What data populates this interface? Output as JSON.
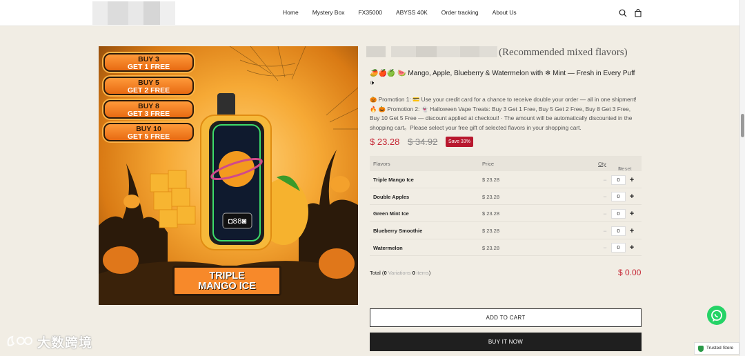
{
  "header": {
    "nav": [
      "Home",
      "Mystery Box",
      "FX35000",
      "ABYSS 40K",
      "Order tracking",
      "About Us"
    ]
  },
  "product": {
    "title": "(Recommended mixed flavors)",
    "tagline": "Mango, Apple, Blueberry & Watermelon with ❄ Mint — Fresh in Every Puff",
    "tagline_prefix": "🥭🍎🍏 🍉",
    "tagline_suffix": "🕩",
    "promo_text": "🎃 Promotion 1: 💳 Use your credit card for a chance to receive double your order — all in one shipment! 🔥 🎃 Promotion 2: 👻 Halloween Vape Treats: Buy 3 Get 1 Free, Buy 5 Get 2 Free, Buy 8 Get 3 Free, Buy 10 Get 5 Free — discount applied at checkout! · The amount will be automatically discounted in the shopping cart。Please select your free gift of selected flavors in your shopping cart.",
    "price": "$ 23.28",
    "old_price": "$ 34.92",
    "save_badge": "Save 33%"
  },
  "image": {
    "offers": [
      {
        "line1": "BUY 3",
        "line2": "GET 1 FREE"
      },
      {
        "line1": "BUY 5",
        "line2": "GET 2 FREE"
      },
      {
        "line1": "BUY 8",
        "line2": "GET 3 FREE"
      },
      {
        "line1": "BUY 10",
        "line2": "GET 5 FREE"
      }
    ],
    "title_line1": "TRIPLE",
    "title_line2": "MANGO ICE"
  },
  "table": {
    "col_flavors": "Flavors",
    "col_price": "Price",
    "col_qty": "Qty",
    "reset": "Reset",
    "rows": [
      {
        "flavor": "Triple Mango Ice",
        "price": "$ 23.28",
        "qty": "0"
      },
      {
        "flavor": "Double Apples",
        "price": "$ 23.28",
        "qty": "0"
      },
      {
        "flavor": "Green Mint Ice",
        "price": "$ 23.28",
        "qty": "0"
      },
      {
        "flavor": "Blueberry Smoothie",
        "price": "$ 23.28",
        "qty": "0"
      },
      {
        "flavor": "Watermelon",
        "price": "$ 23.28",
        "qty": "0"
      }
    ]
  },
  "total": {
    "label": "Total",
    "variations_count": "0",
    "variations_label": "Variations",
    "items_count": "0",
    "items_label": "items",
    "amount": "$ 0.00"
  },
  "buttons": {
    "add_to_cart": "ADD TO CART",
    "buy_now": "BUY IT NOW"
  },
  "trusted_store": "Trusted Store",
  "watermark": "大数跨境",
  "colors": {
    "accent_red": "#c62836",
    "dark_button": "#1f1f1f",
    "whatsapp_green": "#25d366"
  }
}
